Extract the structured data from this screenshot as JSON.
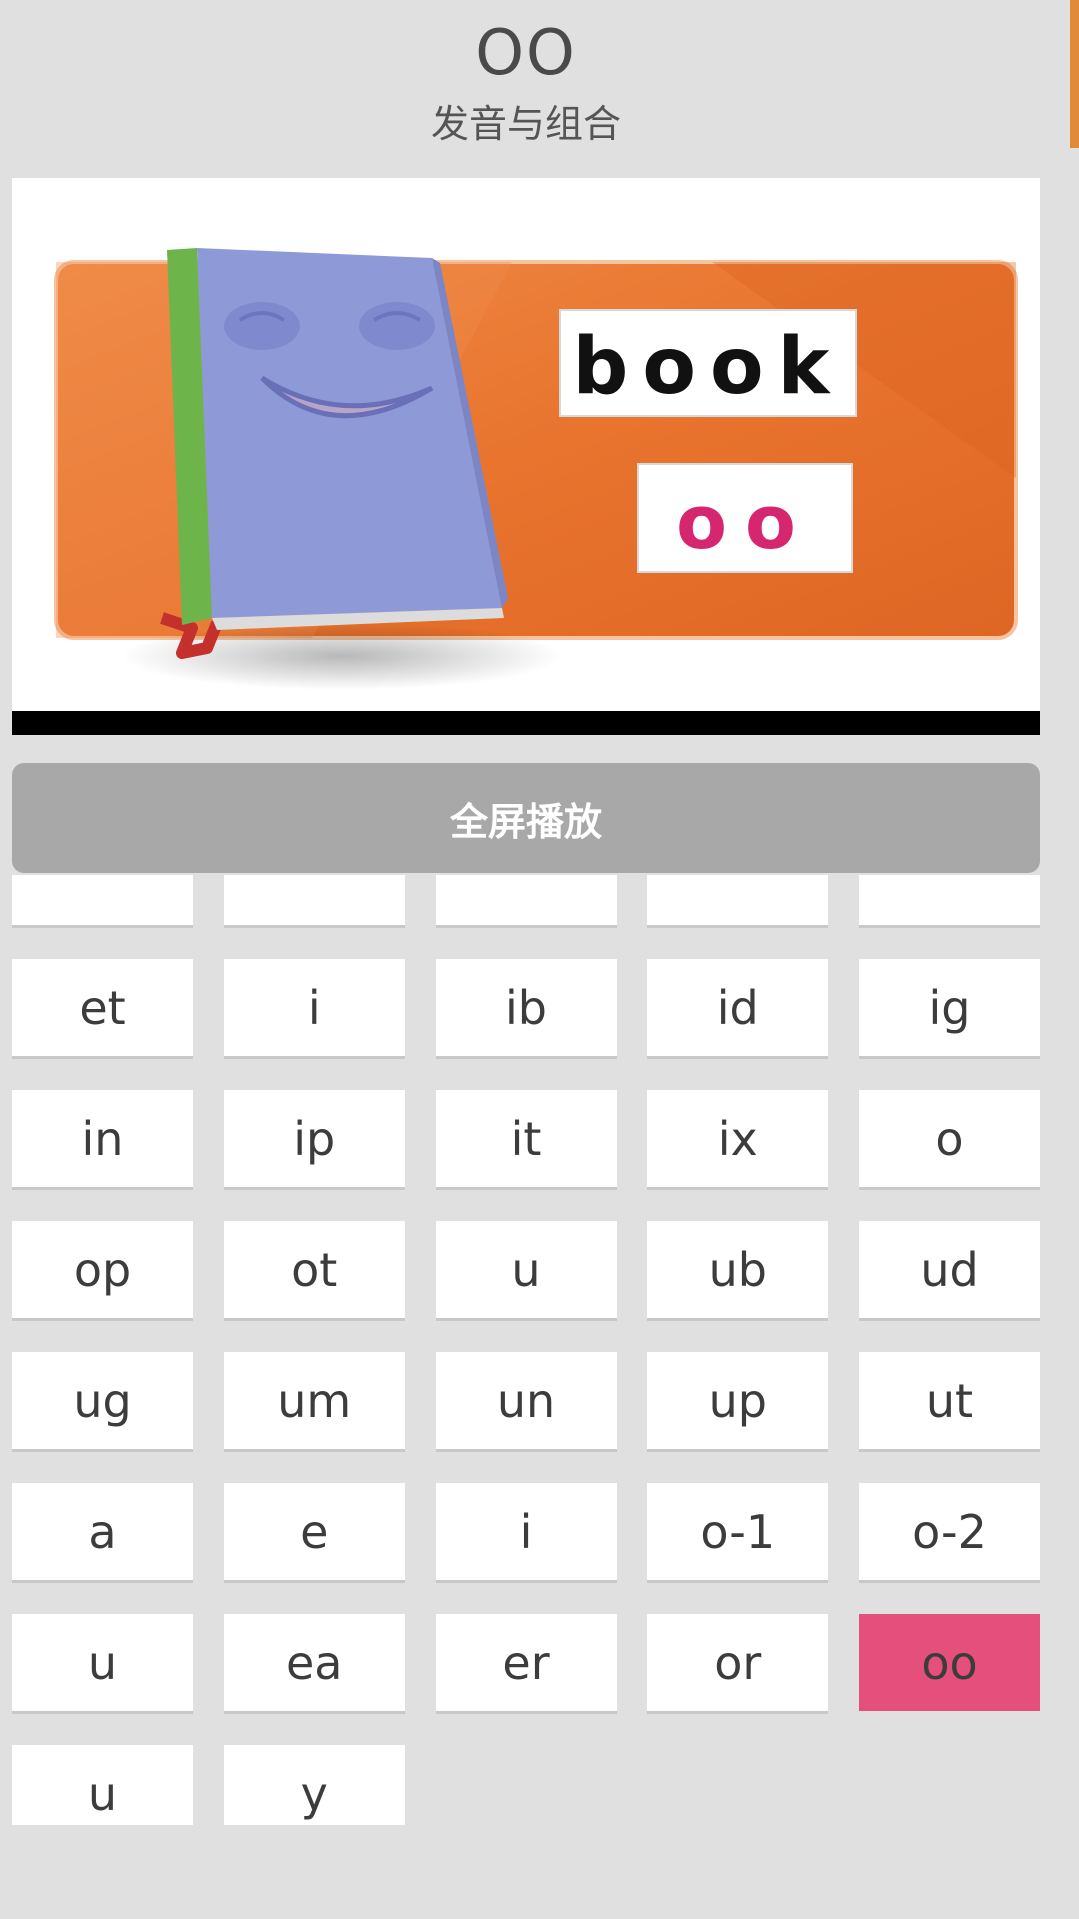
{
  "header": {
    "title": "OO",
    "subtitle": "发音与组合"
  },
  "video": {
    "word": "book",
    "sound": "oo",
    "colors": {
      "background": "#e8742e",
      "book_cover": "#8e9ad8",
      "book_spine": "#6db54a",
      "sound_letters": "#d6266f"
    }
  },
  "actions": {
    "fullscreen_label": "全屏播放"
  },
  "tiles": {
    "selected_color": "#e54f7b",
    "items": [
      {
        "label": "",
        "selected": false
      },
      {
        "label": "",
        "selected": false
      },
      {
        "label": "",
        "selected": false
      },
      {
        "label": "",
        "selected": false
      },
      {
        "label": "",
        "selected": false
      },
      {
        "label": "et",
        "selected": false
      },
      {
        "label": "i",
        "selected": false
      },
      {
        "label": "ib",
        "selected": false
      },
      {
        "label": "id",
        "selected": false
      },
      {
        "label": "ig",
        "selected": false
      },
      {
        "label": "in",
        "selected": false
      },
      {
        "label": "ip",
        "selected": false
      },
      {
        "label": "it",
        "selected": false
      },
      {
        "label": "ix",
        "selected": false
      },
      {
        "label": "o",
        "selected": false
      },
      {
        "label": "op",
        "selected": false
      },
      {
        "label": "ot",
        "selected": false
      },
      {
        "label": "u",
        "selected": false
      },
      {
        "label": "ub",
        "selected": false
      },
      {
        "label": "ud",
        "selected": false
      },
      {
        "label": "ug",
        "selected": false
      },
      {
        "label": "um",
        "selected": false
      },
      {
        "label": "un",
        "selected": false
      },
      {
        "label": "up",
        "selected": false
      },
      {
        "label": "ut",
        "selected": false
      },
      {
        "label": "a",
        "selected": false
      },
      {
        "label": "e",
        "selected": false
      },
      {
        "label": "i",
        "selected": false
      },
      {
        "label": "o-1",
        "selected": false
      },
      {
        "label": "o-2",
        "selected": false
      },
      {
        "label": "u",
        "selected": false
      },
      {
        "label": "ea",
        "selected": false
      },
      {
        "label": "er",
        "selected": false
      },
      {
        "label": "or",
        "selected": false
      },
      {
        "label": "oo",
        "selected": true
      },
      {
        "label": "u",
        "selected": false
      },
      {
        "label": "y",
        "selected": false
      }
    ]
  }
}
